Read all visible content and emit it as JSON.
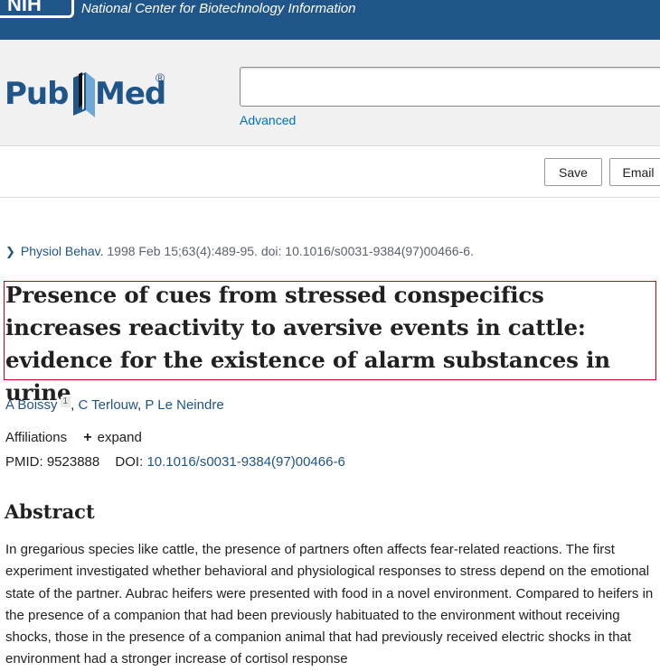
{
  "ncbi": {
    "logo": "NIH",
    "title": "National Center for Biotechnology Information"
  },
  "header": {
    "logo_pub": "Pub",
    "logo_med": "Med",
    "logo_reg": "®",
    "search_value": "",
    "advanced_label": "Advanced"
  },
  "actions": {
    "save_label": "Save",
    "email_label": "Email"
  },
  "citation": {
    "journal": "Physiol Behav.",
    "details": " 1998 Feb 15;63(4):489-95. doi: 10.1016/s0031-9384(97)00466-6."
  },
  "article": {
    "title": "Presence of cues from stressed conspecifics increases reactivity to aversive events in cattle: evidence for the existence of alarm substances in urine",
    "authors": [
      {
        "name": "A Boissy",
        "affiliation_ref": "1"
      },
      {
        "name": "C Terlouw"
      },
      {
        "name": "P Le Neindre"
      }
    ],
    "affiliations_label": "Affiliations",
    "expand_label": "expand",
    "pmid_label": "PMID:",
    "pmid": "9523888",
    "doi_label": "DOI:",
    "doi": "10.1016/s0031-9384(97)00466-6"
  },
  "abstract": {
    "heading": "Abstract",
    "text": "In gregarious species like cattle, the presence of partners often affects fear-related reactions. The first experiment investigated whether behavioral and physiological responses to stress depend on the emotional state of the partner. Aubrac heifers were presented with food in a novel environment. Compared to heifers in the presence of a companion that had been previously habituated to the environment without receiving shocks, those in the presence of a companion animal that had previously received electric shocks in that environment had a stronger increase of cortisol response"
  },
  "colors": {
    "ncbi_blue": "#20558a",
    "link": "#0071bc",
    "highlight_border": "#d0021b"
  }
}
